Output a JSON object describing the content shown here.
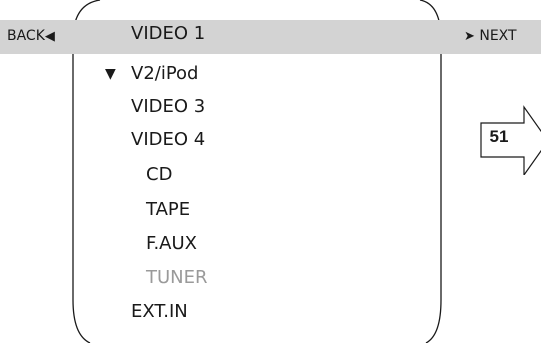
{
  "nav": {
    "back_label": "BACK",
    "back_arrow": "◀",
    "next_label": "NEXT",
    "next_arrow": "➤"
  },
  "menu": {
    "items": [
      {
        "label": "VIDEO 1"
      },
      {
        "label": "V2/iPod"
      },
      {
        "label": "VIDEO 3"
      },
      {
        "label": "VIDEO 4"
      },
      {
        "label": "CD"
      },
      {
        "label": "TAPE"
      },
      {
        "label": "F.AUX"
      },
      {
        "label": "TUNER"
      },
      {
        "label": "EXT.IN"
      }
    ],
    "selected_index": 0,
    "cursor_index": 1,
    "cursor_glyph": "▼",
    "disabled_index": 7
  },
  "page_ref": {
    "number": "51"
  },
  "colors": {
    "highlight": "#d3d3d3",
    "text": "#1a1a1a",
    "disabled_text": "#9a9a9a",
    "background": "#ffffff"
  }
}
